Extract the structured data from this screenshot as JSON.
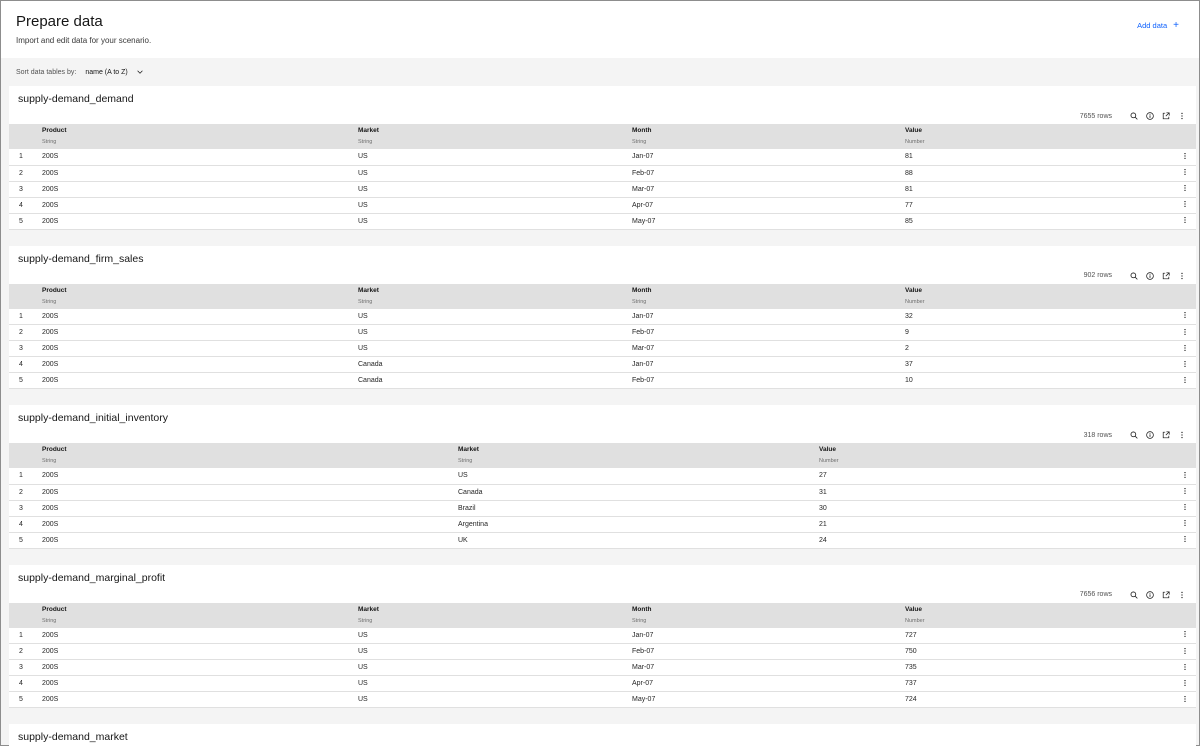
{
  "header": {
    "title": "Prepare data",
    "subtitle": "Import and edit data for your scenario.",
    "add_data_label": "Add data",
    "add_data_icon": "+"
  },
  "sort": {
    "label": "Sort data tables by:",
    "value": "name (A to Z)"
  },
  "tables": [
    {
      "name": "supply-demand_demand",
      "rows_label": "7655 rows",
      "columns": [
        {
          "name": "Product",
          "type": "String"
        },
        {
          "name": "Market",
          "type": "String"
        },
        {
          "name": "Month",
          "type": "String"
        },
        {
          "name": "Value",
          "type": "Number"
        }
      ],
      "rows": [
        [
          "1",
          "200S",
          "US",
          "Jan-07",
          "81"
        ],
        [
          "2",
          "200S",
          "US",
          "Feb-07",
          "88"
        ],
        [
          "3",
          "200S",
          "US",
          "Mar-07",
          "81"
        ],
        [
          "4",
          "200S",
          "US",
          "Apr-07",
          "77"
        ],
        [
          "5",
          "200S",
          "US",
          "May-07",
          "85"
        ]
      ]
    },
    {
      "name": "supply-demand_firm_sales",
      "rows_label": "902 rows",
      "columns": [
        {
          "name": "Product",
          "type": "String"
        },
        {
          "name": "Market",
          "type": "String"
        },
        {
          "name": "Month",
          "type": "String"
        },
        {
          "name": "Value",
          "type": "Number"
        }
      ],
      "rows": [
        [
          "1",
          "200S",
          "US",
          "Jan-07",
          "32"
        ],
        [
          "2",
          "200S",
          "US",
          "Feb-07",
          "9"
        ],
        [
          "3",
          "200S",
          "US",
          "Mar-07",
          "2"
        ],
        [
          "4",
          "200S",
          "Canada",
          "Jan-07",
          "37"
        ],
        [
          "5",
          "200S",
          "Canada",
          "Feb-07",
          "10"
        ]
      ]
    },
    {
      "name": "supply-demand_initial_inventory",
      "rows_label": "318 rows",
      "columns": [
        {
          "name": "Product",
          "type": "String"
        },
        {
          "name": "Market",
          "type": "String"
        },
        {
          "name": "Value",
          "type": "Number"
        }
      ],
      "rows": [
        [
          "1",
          "200S",
          "US",
          "27"
        ],
        [
          "2",
          "200S",
          "Canada",
          "31"
        ],
        [
          "3",
          "200S",
          "Brazil",
          "30"
        ],
        [
          "4",
          "200S",
          "Argentina",
          "21"
        ],
        [
          "5",
          "200S",
          "UK",
          "24"
        ]
      ]
    },
    {
      "name": "supply-demand_marginal_profit",
      "rows_label": "7656 rows",
      "columns": [
        {
          "name": "Product",
          "type": "String"
        },
        {
          "name": "Market",
          "type": "String"
        },
        {
          "name": "Month",
          "type": "String"
        },
        {
          "name": "Value",
          "type": "Number"
        }
      ],
      "rows": [
        [
          "1",
          "200S",
          "US",
          "Jan-07",
          "727"
        ],
        [
          "2",
          "200S",
          "US",
          "Feb-07",
          "750"
        ],
        [
          "3",
          "200S",
          "US",
          "Mar-07",
          "735"
        ],
        [
          "4",
          "200S",
          "US",
          "Apr-07",
          "737"
        ],
        [
          "5",
          "200S",
          "US",
          "May-07",
          "724"
        ]
      ]
    }
  ],
  "last_table": {
    "name": "supply-demand_market"
  },
  "icons": {
    "search": "search-icon",
    "info": "info-icon",
    "open": "launch-icon",
    "menu": "overflow-menu-icon"
  },
  "colors": {
    "link": "#0f62fe",
    "header_row": "#e0e0e0",
    "background": "#f4f4f4"
  }
}
